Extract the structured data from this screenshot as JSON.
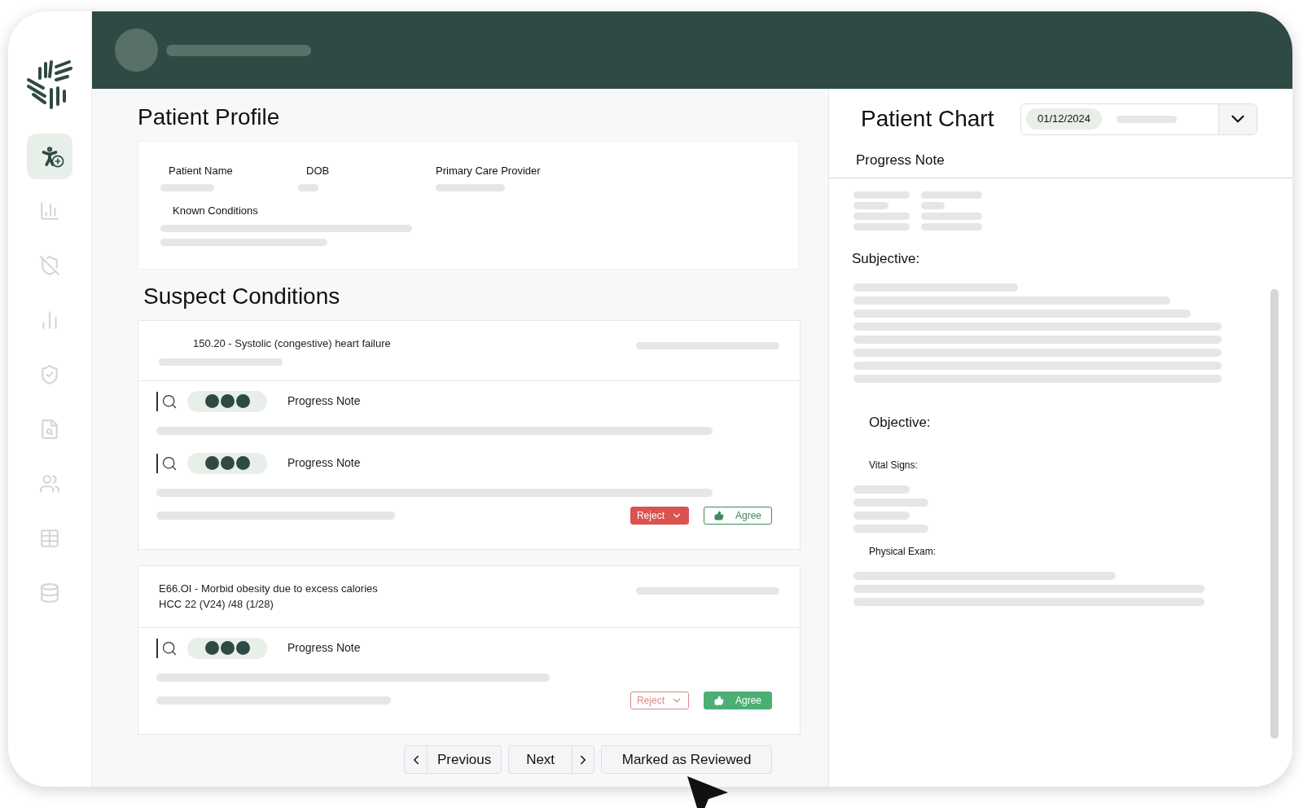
{
  "sidebar": {
    "items": [
      {
        "selected": true
      },
      {
        "selected": false
      },
      {
        "selected": false
      },
      {
        "selected": false
      },
      {
        "selected": false
      },
      {
        "selected": false
      },
      {
        "selected": false
      },
      {
        "selected": false
      },
      {
        "selected": false
      }
    ]
  },
  "profile": {
    "title": "Patient Profile",
    "fields": [
      {
        "label": "Patient Name"
      },
      {
        "label": "DOB"
      },
      {
        "label": "Primary Care Provider"
      },
      {
        "label": "Known Conditions"
      }
    ]
  },
  "suspect_conditions": {
    "title": "Suspect Conditions",
    "cards": [
      {
        "title": "150.20 - Systolic (congestive) heart failure",
        "evidence": [
          {
            "label": "Progress Note"
          },
          {
            "label": "Progress Note"
          }
        ],
        "reject": {
          "label": "Reject",
          "selected": true
        },
        "agree": {
          "label": "Agree",
          "selected": false
        }
      },
      {
        "title": "E66.OI - Morbid obesity due to excess calories",
        "subtitle": "HCC 22 (V24) /48 (1/28)",
        "evidence": [
          {
            "label": "Progress Note"
          }
        ],
        "reject": {
          "label": "Reject",
          "selected": false
        },
        "agree": {
          "label": "Agree",
          "selected": true
        }
      }
    ]
  },
  "pagination": {
    "previous": "Previous",
    "next": "Next",
    "review": "Marked as Reviewed"
  },
  "chart": {
    "title": "Patient Chart",
    "date": "01/12/2024",
    "tab": "Progress Note",
    "sections": [
      {
        "kind": "heading",
        "label": "Subjective:"
      },
      {
        "kind": "subheading",
        "label": "Objective:"
      },
      {
        "kind": "label",
        "label": "Vital Signs:"
      },
      {
        "kind": "label",
        "label": "Physical Exam:"
      }
    ]
  }
}
